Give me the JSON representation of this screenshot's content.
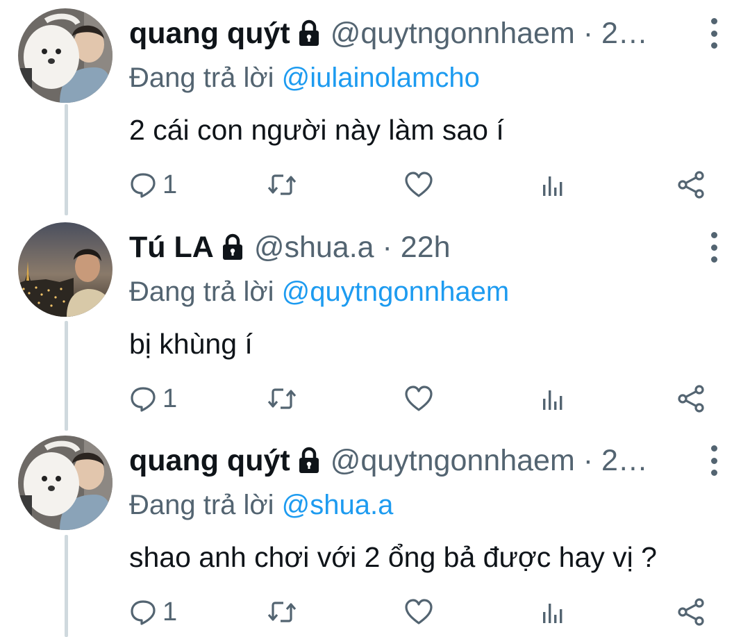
{
  "tweets": [
    {
      "display_name": "quang quýt",
      "handle_time": "@quytngonnhaem · 2…",
      "replying_label": "Đang trả lời",
      "replying_to": "@iulainolamcho",
      "text": "2 cái con người này làm sao í",
      "reply_count": "1",
      "avatar": "dog-and-boy-avatar"
    },
    {
      "display_name": "Tú LA",
      "handle_time": "@shua.a · 22h",
      "replying_label": "Đang trả lời",
      "replying_to": "@quytngonnhaem",
      "text": "bị khùng í",
      "reply_count": "1",
      "avatar": "city-night-avatar"
    },
    {
      "display_name": "quang quýt",
      "handle_time": "@quytngonnhaem · 2…",
      "replying_label": "Đang trả lời",
      "replying_to": "@shua.a",
      "text": "shao anh chơi với 2 ổng bả được hay vị ?",
      "reply_count": "1",
      "avatar": "dog-and-boy-avatar"
    }
  ],
  "icons": {
    "reply": "reply-icon",
    "retweet": "retweet-icon",
    "like": "heart-icon",
    "views": "analytics-icon",
    "share": "share-icon",
    "lock": "lock-icon",
    "more": "more-icon"
  },
  "colors": {
    "text": "#0f1419",
    "secondary": "#536471",
    "mention": "#1d9bf0",
    "thread_line": "#cfd9de"
  }
}
